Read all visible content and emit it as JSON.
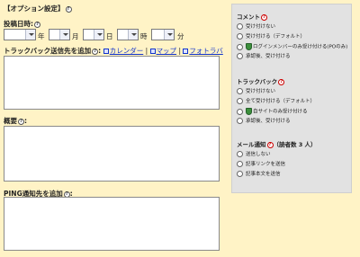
{
  "header": {
    "title": "【オプション設定】"
  },
  "post_datetime": {
    "label": "投稿日時",
    "units": {
      "year": "年",
      "month": "月",
      "day": "日",
      "hour": "時",
      "minute": "分"
    }
  },
  "trackback_to": {
    "label": "トラックバック送信先を追加",
    "links": [
      "カレンダー",
      "マップ",
      "フォトラバ"
    ],
    "separator": "|"
  },
  "summary": {
    "label": "概要"
  },
  "ping": {
    "label": "PING通知先を追加"
  },
  "panel": {
    "comment": {
      "title": "コメント",
      "options": [
        "受け付けない",
        "受け付ける（デフォルト）",
        "ログインメンバーのみ受け付ける(POのみ)",
        "承認後、受け付ける"
      ]
    },
    "trackback": {
      "title": "トラックバック",
      "options": [
        "受け付けない",
        "全て受け付ける（デフォルト）",
        "自サイトのみ受け付ける",
        "承認後、受け付ける"
      ]
    },
    "mail": {
      "title": "メール通知",
      "subtitle": "（読者数 3 人）",
      "options": [
        "送信しない",
        "記事リンクを送信",
        "記事本文を送信"
      ]
    }
  },
  "colors": {
    "background": "#fff3c6",
    "link": "#1133cc",
    "panel": "#e2e2e2",
    "help_red": "#cc0000"
  },
  "icons": {
    "help": "question-circle-icon",
    "shield": "shield-icon",
    "dropdown": "chevron-down-icon"
  }
}
